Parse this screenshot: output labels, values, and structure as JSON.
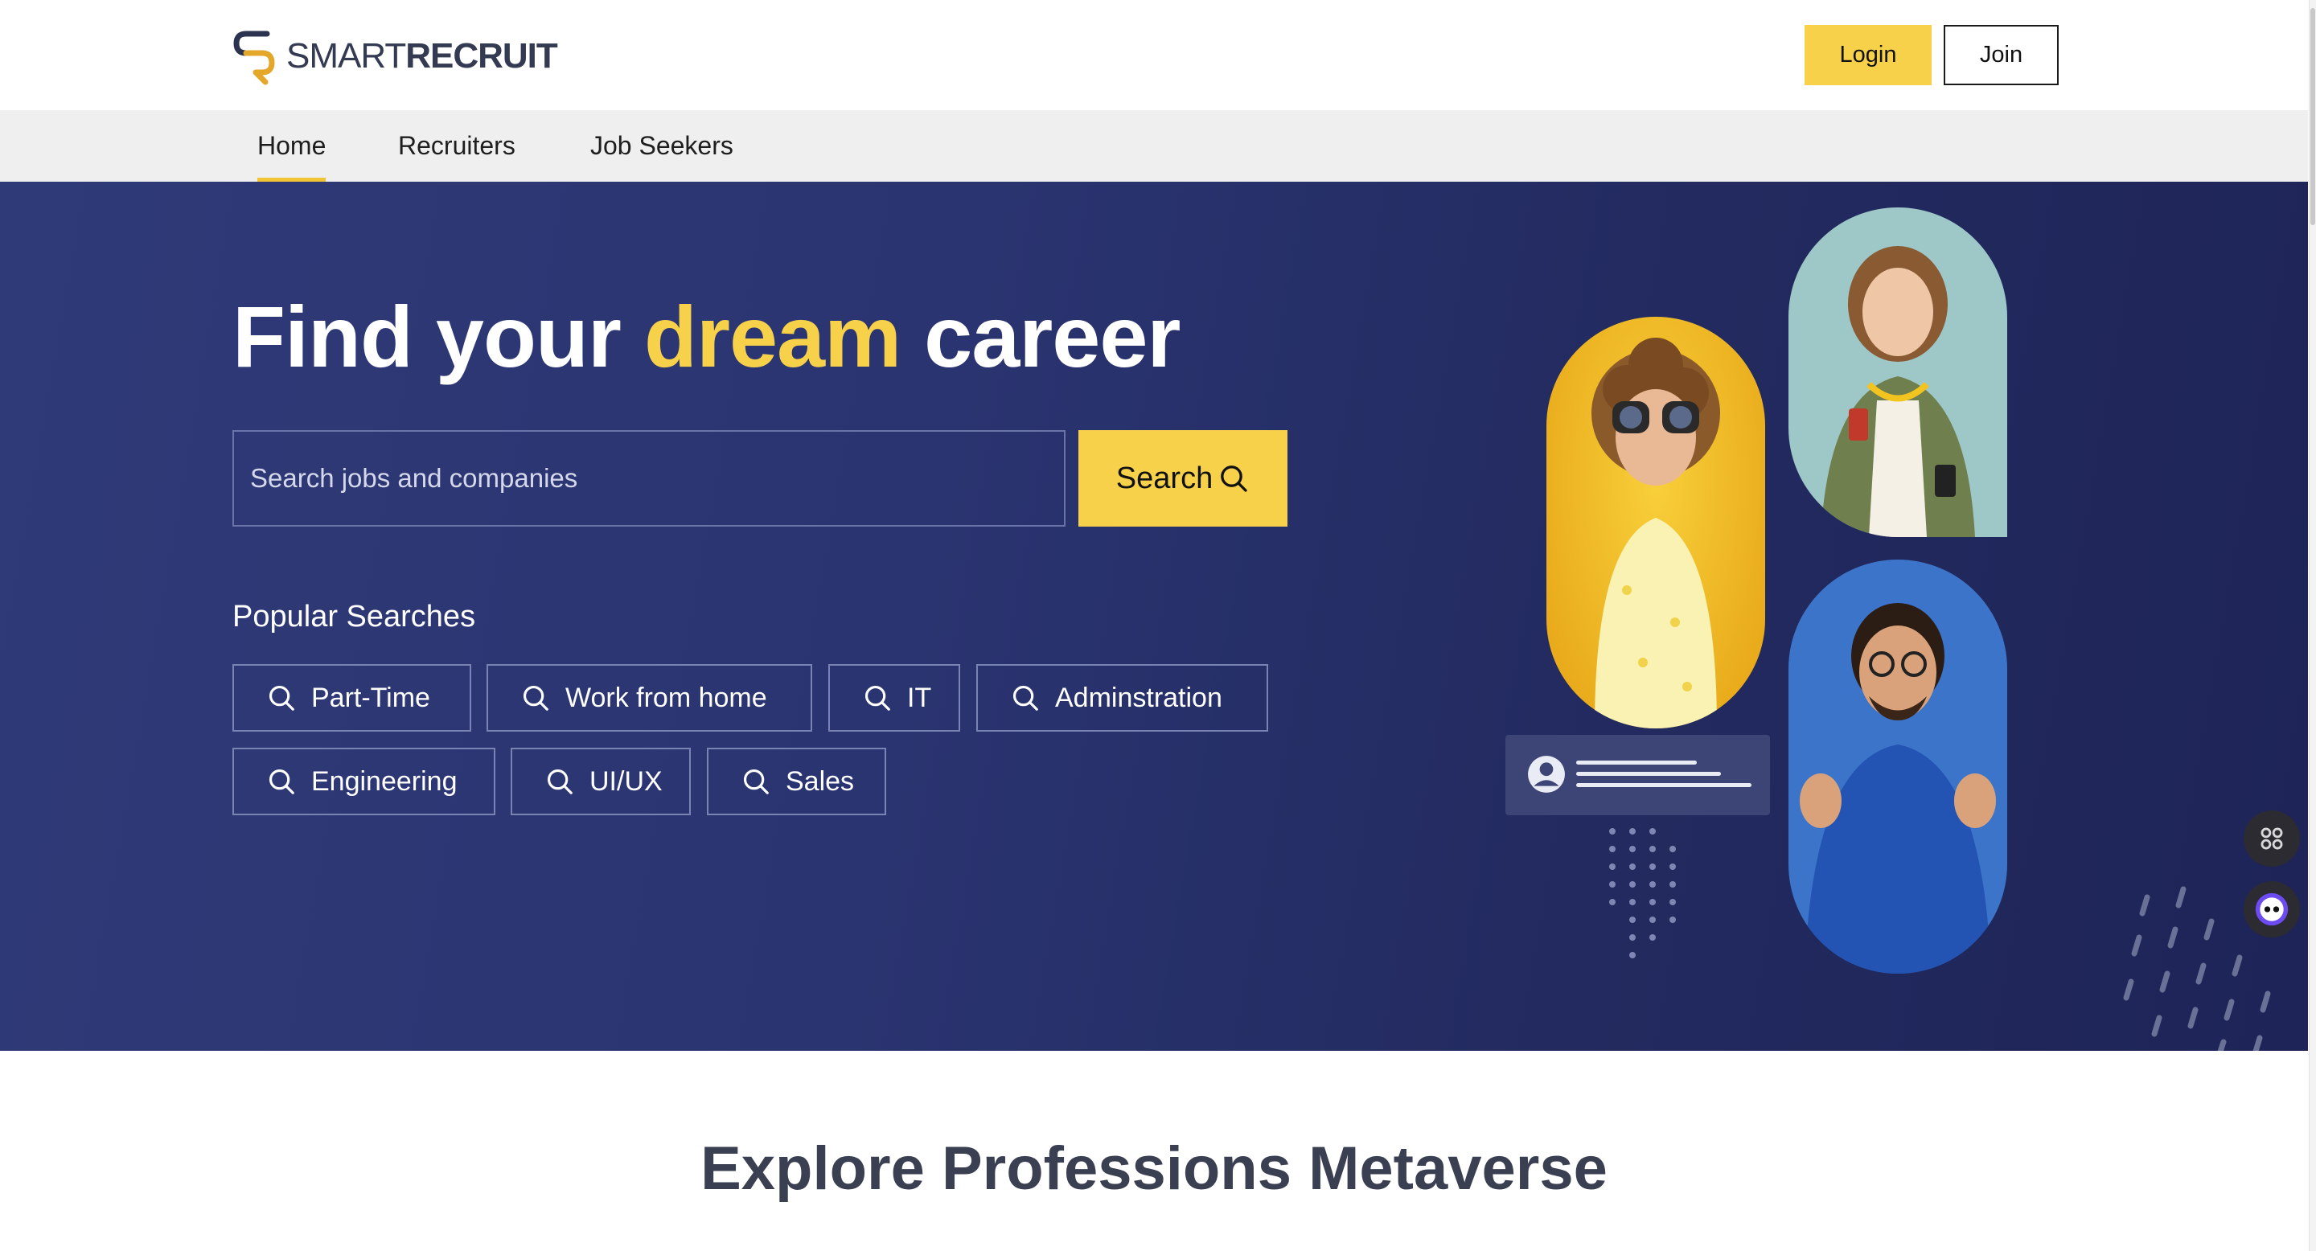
{
  "brand": {
    "name_part1": "SMART",
    "name_part2": "RECRUIT",
    "logo_icon": "sr-logo-icon"
  },
  "header": {
    "login_label": "Login",
    "join_label": "Join"
  },
  "nav": {
    "items": [
      {
        "label": "Home",
        "active": true
      },
      {
        "label": "Recruiters",
        "active": false
      },
      {
        "label": "Job Seekers",
        "active": false
      }
    ]
  },
  "hero": {
    "title_before": "Find your ",
    "title_accent": "dream",
    "title_after": " career",
    "search_placeholder": "Search jobs and companies",
    "search_button": "Search",
    "popular_label": "Popular Searches",
    "chips": [
      "Part-Time",
      "Work from home",
      "IT",
      "Adminstration",
      "Engineering",
      "UI/UX",
      "Sales"
    ]
  },
  "explore": {
    "title": "Explore Professions Metaverse"
  },
  "colors": {
    "accent": "#f7d14a",
    "hero_bg": "#2a3470",
    "title_text": "#3b3f52"
  },
  "icons": {
    "search": "search-icon",
    "apps_widget": "grid-icon",
    "chat_widget": "chat-bot-icon"
  }
}
